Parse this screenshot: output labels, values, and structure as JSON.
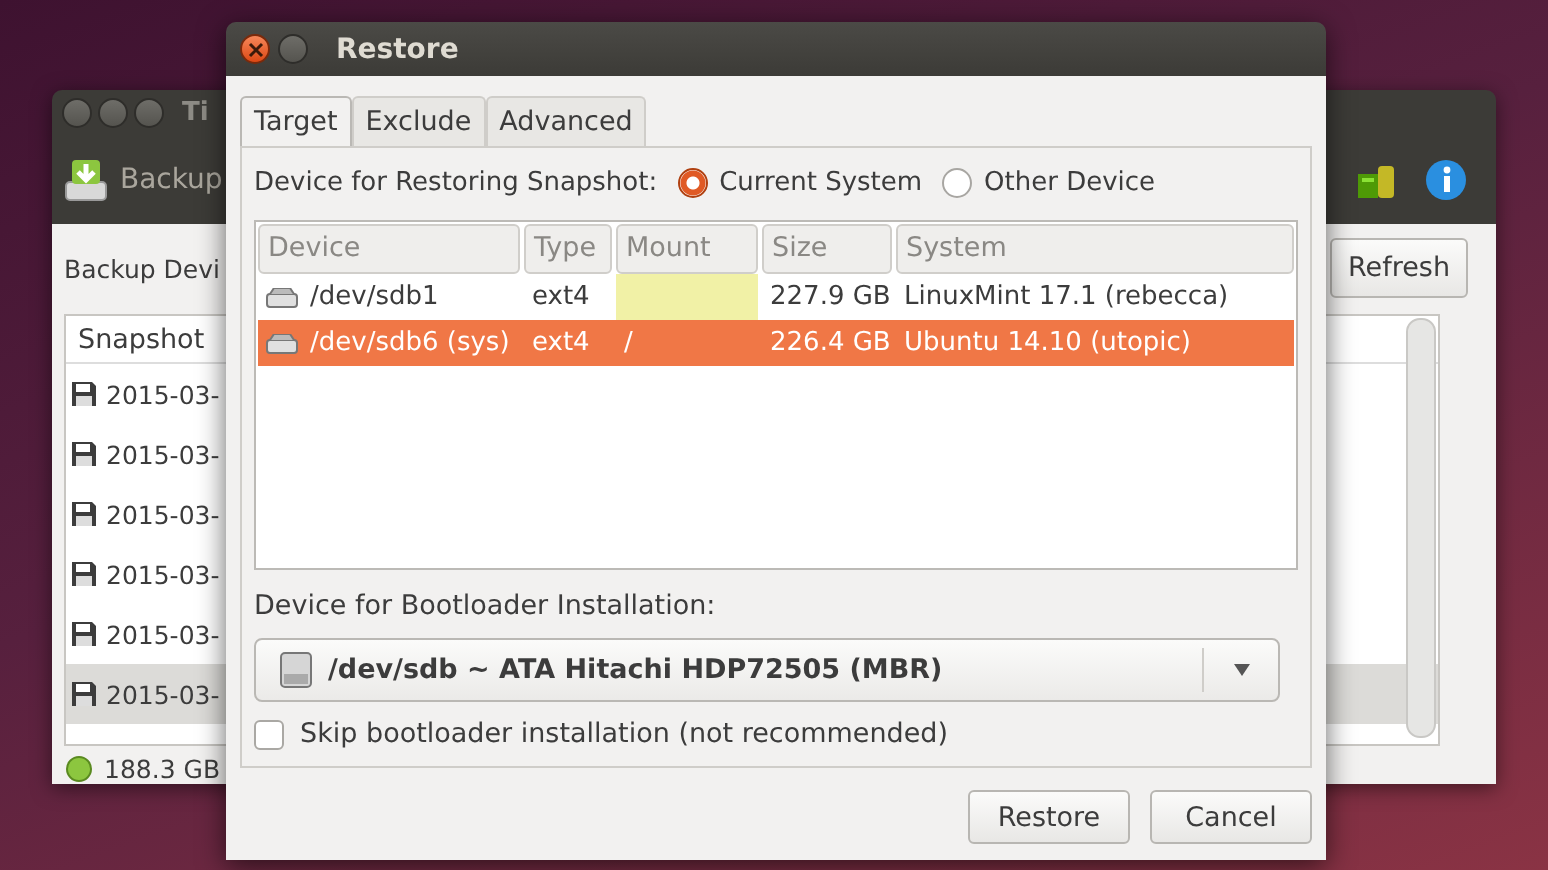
{
  "background_window": {
    "title": "Ti",
    "toolbar_button": "Backup",
    "device_label": "Backup Devi",
    "refresh_button": "Refresh",
    "snapshot_list": {
      "column": "Snapshot",
      "rows": [
        {
          "text": "2015-03-",
          "selected": false
        },
        {
          "text": "2015-03-",
          "selected": false
        },
        {
          "text": "2015-03-",
          "selected": false
        },
        {
          "text": "2015-03-",
          "selected": false
        },
        {
          "text": "2015-03-",
          "selected": false
        },
        {
          "text": "2015-03-",
          "selected": true
        }
      ]
    },
    "status": "188.3 GB"
  },
  "dialog": {
    "title": "Restore",
    "tabs": [
      {
        "label": "Target",
        "selected": true
      },
      {
        "label": "Exclude",
        "selected": false
      },
      {
        "label": "Advanced",
        "selected": false
      }
    ],
    "restore_label": "Device for Restoring Snapshot:",
    "radios": [
      {
        "label": "Current System",
        "selected": true
      },
      {
        "label": "Other Device",
        "selected": false
      }
    ],
    "table": {
      "columns": [
        "Device",
        "Type",
        "Mount",
        "Size",
        "System"
      ],
      "rows": [
        {
          "device": "/dev/sdb1",
          "type": "ext4",
          "mount_highlight": true,
          "size": "227.9 GB",
          "system": "LinuxMint 17.1 (rebecca)",
          "selected": false
        },
        {
          "device": "/dev/sdb6 (sys)",
          "type": "ext4",
          "mount": "/",
          "mount_highlight": false,
          "size": "226.4 GB",
          "system": "Ubuntu 14.10 (utopic)",
          "selected": true
        }
      ]
    },
    "bootloader_label": "Device for Bootloader Installation:",
    "bootloader_combo": {
      "value": "/dev/sdb ~ ATA Hitachi HDP72505 (MBR)"
    },
    "skip_checkbox": {
      "label": "Skip bootloader installation (not recommended)",
      "checked": false
    },
    "buttons": [
      "Restore",
      "Cancel"
    ]
  }
}
